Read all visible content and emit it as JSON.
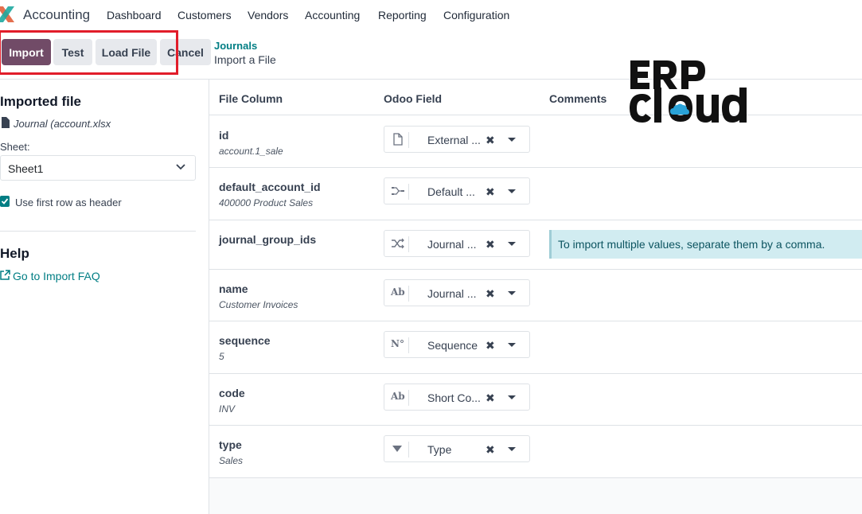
{
  "navbar": {
    "app_name": "Accounting",
    "menu": [
      "Dashboard",
      "Customers",
      "Vendors",
      "Accounting",
      "Reporting",
      "Configuration"
    ]
  },
  "control": {
    "import_label": "Import",
    "test_label": "Test",
    "load_file_label": "Load File",
    "cancel_label": "Cancel",
    "breadcrumb_parent": "Journals",
    "breadcrumb_current": "Import a File"
  },
  "sidebar": {
    "imported_title": "Imported file",
    "file_name": "Journal (account.xlsx",
    "sheet_label": "Sheet:",
    "sheet_value": "Sheet1",
    "header_checkbox_label": "Use first row as header",
    "header_checkbox_checked": true,
    "help_title": "Help",
    "faq_link": "Go to Import FAQ"
  },
  "table": {
    "headers": [
      "File Column",
      "Odoo Field",
      "Comments"
    ],
    "rows": [
      {
        "name": "id",
        "sample": "account.1_sale",
        "field": "External ...",
        "icon": "file-icon",
        "comment": ""
      },
      {
        "name": "default_account_id",
        "sample": "400000 Product Sales",
        "field": "Default ...",
        "icon": "many2one-icon",
        "comment": ""
      },
      {
        "name": "journal_group_ids",
        "sample": "",
        "field": "Journal ...",
        "icon": "many2many-icon",
        "comment": "To import multiple values, separate them by a comma."
      },
      {
        "name": "name",
        "sample": "Customer Invoices",
        "field": "Journal ...",
        "icon": "text-icon",
        "icon_text": "Ab",
        "comment": ""
      },
      {
        "name": "sequence",
        "sample": "5",
        "field": "Sequence",
        "icon": "number-icon",
        "icon_text": "N°",
        "comment": ""
      },
      {
        "name": "code",
        "sample": "INV",
        "field": "Short Co...",
        "icon": "text-icon",
        "icon_text": "Ab",
        "comment": ""
      },
      {
        "name": "type",
        "sample": "Sales",
        "field": "Type",
        "icon": "selection-icon",
        "comment": ""
      }
    ],
    "clear_glyph": "✖"
  },
  "colors": {
    "primary": "#714b67",
    "link": "#017e84",
    "highlight": "#e11d2a",
    "info_bg": "#d1ecf1"
  }
}
